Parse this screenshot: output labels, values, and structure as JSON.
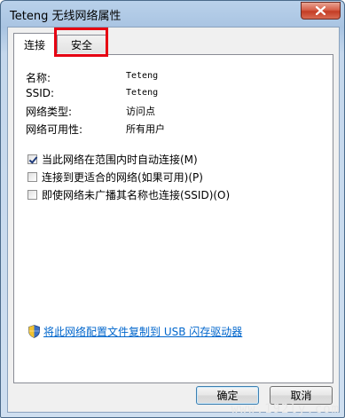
{
  "window": {
    "title": "Teteng 无线网络属性",
    "close_icon": "close-icon"
  },
  "tabs": [
    {
      "label": "连接",
      "active": true
    },
    {
      "label": "安全",
      "active": false
    }
  ],
  "info": [
    {
      "label": "名称:",
      "value": "Teteng"
    },
    {
      "label": "SSID:",
      "value": "Teteng"
    },
    {
      "label": "网络类型:",
      "value": "访问点"
    },
    {
      "label": "网络可用性:",
      "value": "所有用户"
    }
  ],
  "options": [
    {
      "label": "当此网络在范围内时自动连接(M)",
      "checked": true
    },
    {
      "label": "连接到更适合的网络(如果可用)(P)",
      "checked": false
    },
    {
      "label": "即使网络未广播其名称也连接(SSID)(O)",
      "checked": false
    }
  ],
  "copy_link": {
    "icon": "shield-icon",
    "text": "将此网络配置文件复制到 USB 闪存驱动器"
  },
  "buttons": {
    "ok": "确定",
    "cancel": "取消"
  },
  "watermark": "www.192ly.com",
  "colors": {
    "highlight": "#e60012",
    "link": "#0066cc",
    "close": "#c43d25"
  }
}
